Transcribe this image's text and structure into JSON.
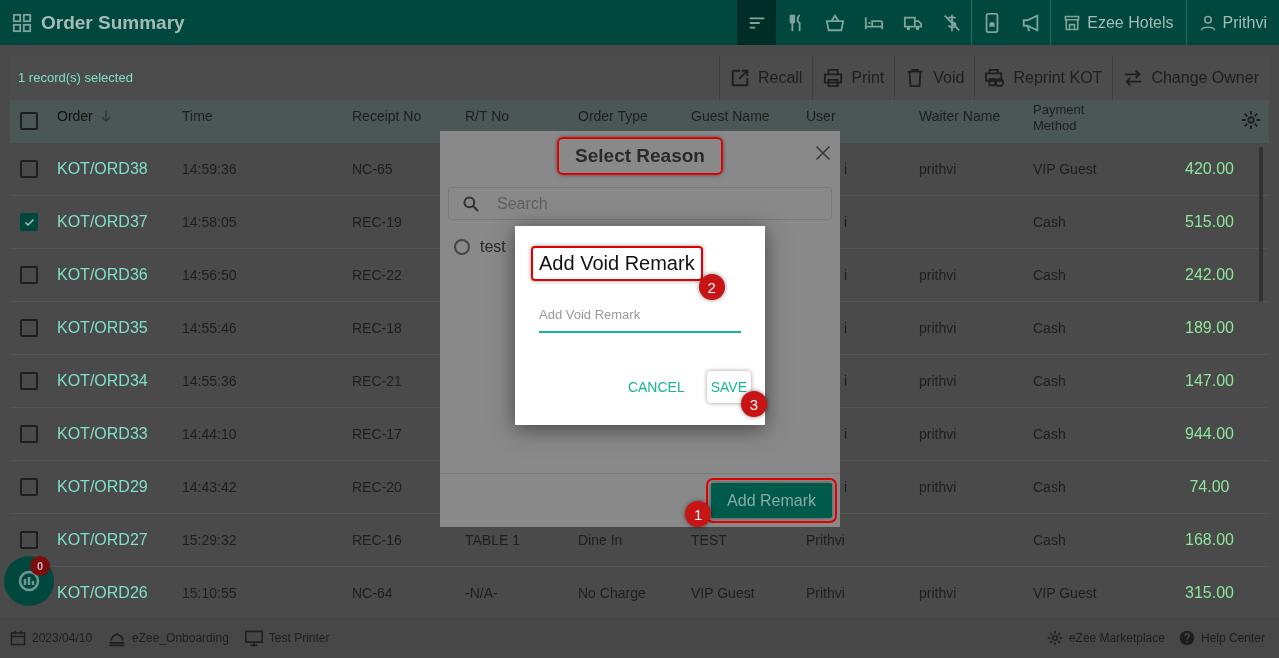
{
  "app_bar": {
    "title": "Order Summary",
    "nav_icons": [
      {
        "kind": "sort",
        "selected": true
      },
      {
        "kind": "cutlery",
        "selected": false
      },
      {
        "kind": "basket",
        "selected": false
      },
      {
        "kind": "bed",
        "selected": false
      },
      {
        "kind": "truck",
        "selected": false
      },
      {
        "kind": "nodollar",
        "selected": false
      },
      {
        "kind": "phone",
        "selected": false
      },
      {
        "kind": "megaphone",
        "selected": false
      }
    ],
    "hotel": "Ezee Hotels",
    "user": "Prithvi"
  },
  "toolbar": {
    "selection_text": "1 record(s) selected",
    "actions": [
      {
        "kind": "recall",
        "label": "Recall"
      },
      {
        "kind": "print",
        "label": "Print"
      },
      {
        "kind": "void",
        "label": "Void"
      },
      {
        "kind": "reprint",
        "label": "Reprint KOT"
      },
      {
        "kind": "owner",
        "label": "Change Owner"
      }
    ]
  },
  "table": {
    "all_checked": false,
    "columns": [
      {
        "label": "Order",
        "sorted": true
      },
      {
        "label": "Time",
        "sorted": false
      },
      {
        "label": "Receipt No",
        "sorted": false
      },
      {
        "label": "R/T No",
        "sorted": false
      },
      {
        "label": "Order Type",
        "sorted": false
      },
      {
        "label": "Guest Name",
        "sorted": false
      },
      {
        "label": "User",
        "sorted": false
      },
      {
        "label": "Waiter Name",
        "sorted": false
      },
      {
        "label": "Payment Method",
        "sorted": false
      }
    ],
    "rows": [
      {
        "checked": false,
        "order": "KOT/ORD38",
        "time": "14:59:36",
        "receipt": "NC-65",
        "user": "i",
        "waiter": "prithvi",
        "payment": "VIP Guest",
        "amount": "420.00"
      },
      {
        "checked": true,
        "order": "KOT/ORD37",
        "time": "14:58:05",
        "receipt": "REC-19",
        "user": "i",
        "payment": "Cash",
        "amount": "515.00"
      },
      {
        "checked": false,
        "order": "KOT/ORD36",
        "time": "14:56:50",
        "receipt": "REC-22",
        "user": "i",
        "waiter": "prithvi",
        "payment": "Cash",
        "amount": "242.00"
      },
      {
        "checked": false,
        "order": "KOT/ORD35",
        "time": "14:55:46",
        "receipt": "REC-18",
        "user": "i",
        "waiter": "prithvi",
        "payment": "Cash",
        "amount": "189.00"
      },
      {
        "checked": false,
        "order": "KOT/ORD34",
        "time": "14:55:36",
        "receipt": "REC-21",
        "user": "i",
        "waiter": "prithvi",
        "payment": "Cash",
        "amount": "147.00"
      },
      {
        "checked": false,
        "order": "KOT/ORD33",
        "time": "14:44:10",
        "receipt": "REC-17",
        "user": "i",
        "waiter": "prithvi",
        "payment": "Cash",
        "amount": "944.00"
      },
      {
        "checked": false,
        "order": "KOT/ORD29",
        "time": "14:43:42",
        "receipt": "REC-20",
        "user": "i",
        "waiter": "prithvi",
        "payment": "Cash",
        "amount": "74.00"
      },
      {
        "checked": false,
        "order": "KOT/ORD27",
        "time": "15:29:32",
        "receipt": "REC-16",
        "rt": "TABLE 1",
        "type": "Dine In",
        "guest": "TEST",
        "user": "Prithvi",
        "payment": "Cash",
        "amount": "168.00"
      },
      {
        "order": "KOT/ORD26",
        "time": "15:10:55",
        "receipt": "NC-64",
        "rt": "-N/A-",
        "type": "No Charge",
        "guest": "VIP Guest",
        "user": "Prithvi",
        "waiter": "prithvi",
        "payment": "VIP Guest",
        "amount": "315.00"
      }
    ]
  },
  "fab": {
    "count": "0"
  },
  "status_bar": {
    "date": "2023/04/10",
    "outlet": "eZee_Onboarding",
    "printer": "Test Printer",
    "links": [
      {
        "kind": "gear",
        "label": "eZee Marketplace"
      },
      {
        "kind": "help",
        "label": "Help Center"
      }
    ]
  },
  "reason_dialog": {
    "title": "Select Reason",
    "title_highlighted": true,
    "search_placeholder": "Search",
    "options": [
      {
        "label": "test",
        "selected": false
      }
    ],
    "add_button": {
      "label": "Add Remark",
      "highlighted": true,
      "callout": "1"
    }
  },
  "remark_dialog": {
    "title": "Add Void Remark",
    "title_highlighted": true,
    "title_callout": "2",
    "placeholder": "Add Void Remark",
    "buttons": [
      {
        "label": "CANCEL",
        "highlighted": false
      },
      {
        "label": "SAVE",
        "highlighted": true,
        "callout": "3"
      }
    ]
  }
}
